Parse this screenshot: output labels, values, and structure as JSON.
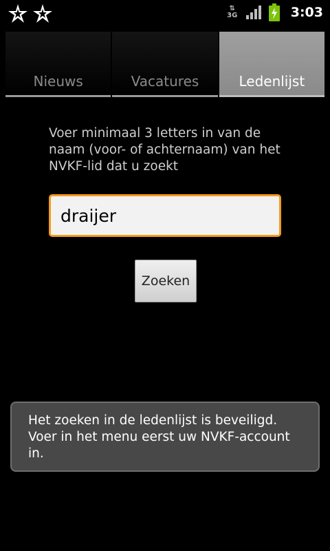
{
  "status_bar": {
    "time": "3:03",
    "network_label": "3G",
    "left_icons": [
      "notification-star-icon",
      "notification-star-icon"
    ],
    "right_icons": [
      "data-3g-icon",
      "signal-strength-icon",
      "battery-charging-icon"
    ],
    "colors": {
      "battery": "#7dc30b",
      "signal": "#bdbdbd"
    }
  },
  "tabs": [
    {
      "label": "Nieuws",
      "selected": false
    },
    {
      "label": "Vacatures",
      "selected": false
    },
    {
      "label": "Ledenlijst",
      "selected": true
    }
  ],
  "main": {
    "instructions": "Voer minimaal 3 letters in van de naam (voor- of achternaam) van het NVKF-lid dat u zoekt",
    "search_value": "draijer",
    "search_button_label": "Zoeken"
  },
  "toast": {
    "message": "Het zoeken in de ledenlijst is beveiligd. Voer in het menu eerst uw NVKF-account in."
  },
  "colors": {
    "input_focus_border": "#f39a1d",
    "toast_background": "#484848"
  }
}
